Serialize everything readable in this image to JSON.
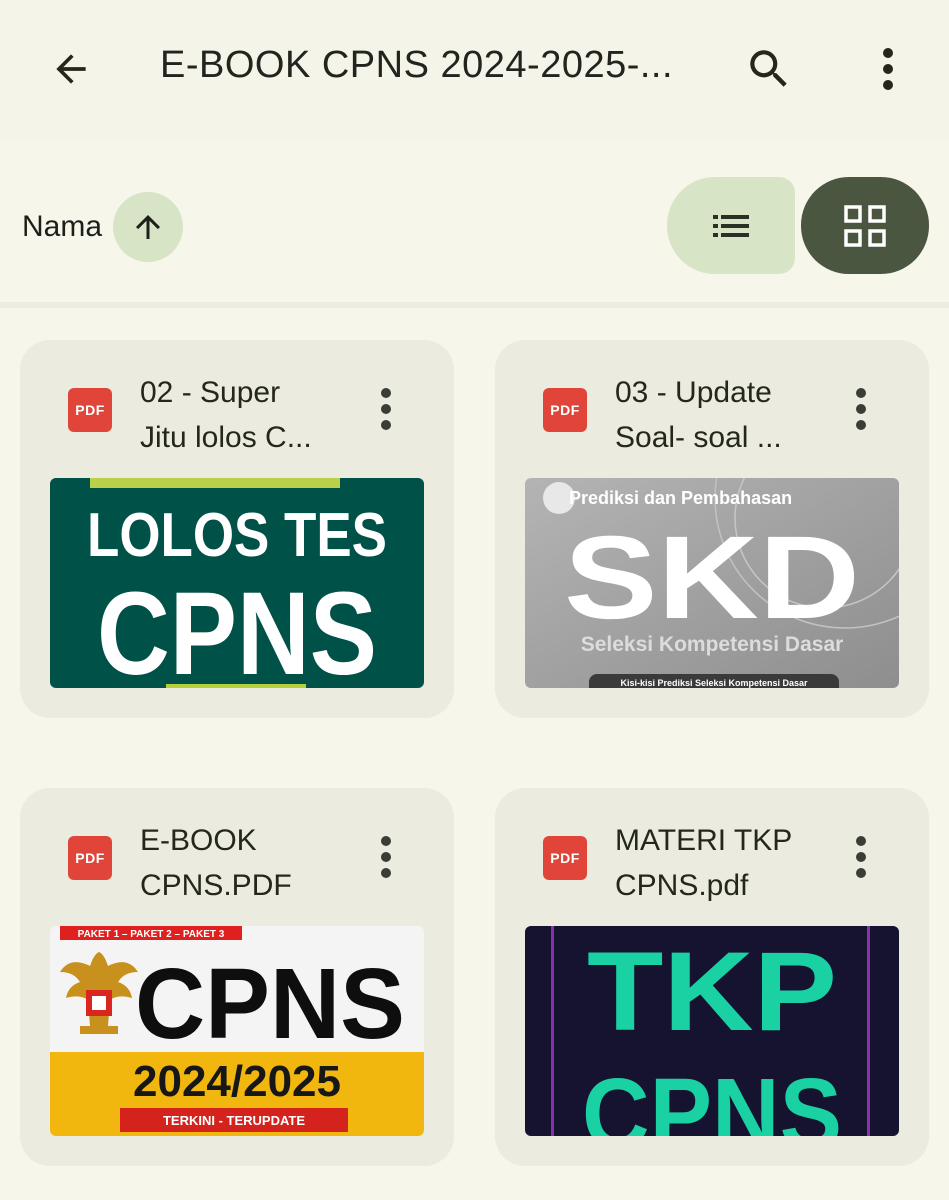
{
  "header": {
    "title": "E-BOOK CPNS 2024-2025-...",
    "back_icon": "arrow-left-icon",
    "search_icon": "search-icon",
    "more_icon": "more-vert-icon"
  },
  "sort": {
    "label": "Nama",
    "direction_icon": "arrow-up-icon",
    "view_options": [
      {
        "name": "list-view",
        "icon": "list-icon",
        "selected": false
      },
      {
        "name": "grid-view",
        "icon": "grid-icon",
        "selected": true
      }
    ]
  },
  "colors": {
    "background": "#f6f6ea",
    "card": "#ebecdf",
    "accent_light": "#d8e4c6",
    "accent_dark": "#4b5640",
    "pdf_red": "#e1453a"
  },
  "files": [
    {
      "badge": "PDF",
      "name_line1": "02 - Super",
      "name_line2": "Jitu lolos C...",
      "thumb": {
        "line1": "LOLOS TES",
        "line2": "CPNS",
        "bg": "#005148"
      }
    },
    {
      "badge": "PDF",
      "name_line1": "03 - Update",
      "name_line2": "Soal- soal ...",
      "thumb": {
        "top": "Prediksi dan Pembahasan",
        "big": "SKD",
        "sub": "Seleksi Kompetensi Dasar",
        "foot": "Kisi-kisi Prediksi Seleksi Kompetensi Dasar"
      }
    },
    {
      "badge": "PDF",
      "name_line1": "E-BOOK",
      "name_line2": "CPNS.PDF",
      "thumb": {
        "strip": "PAKET 1 – PAKET 2 – PAKET 3",
        "big": "CPNS",
        "year": "2024/2025",
        "tag": "TERKINI - TERUPDATE"
      }
    },
    {
      "badge": "PDF",
      "name_line1": "MATERI TKP",
      "name_line2": "CPNS.pdf",
      "thumb": {
        "line1": "TKP",
        "line2": "CPNS",
        "bg": "#161330"
      }
    }
  ]
}
